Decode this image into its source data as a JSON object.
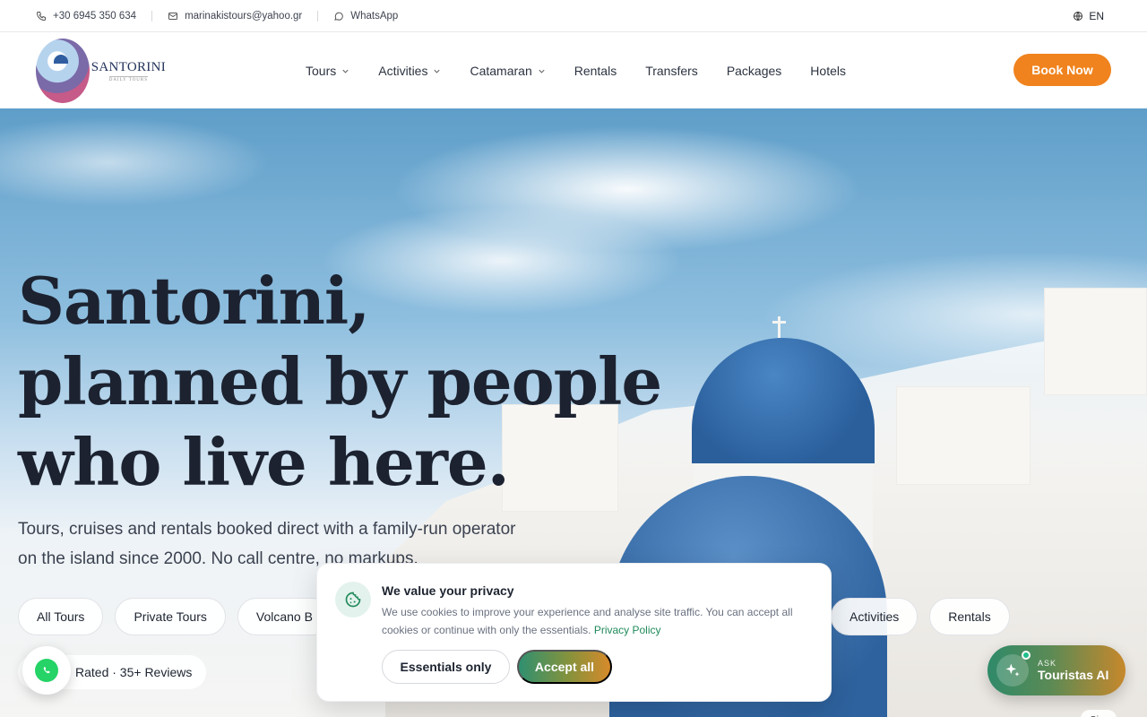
{
  "topbar": {
    "phone": "+30 6945 350 634",
    "email": "marinakistours@yahoo.gr",
    "whatsapp": "WhatsApp",
    "language": "EN"
  },
  "logo": {
    "title": "SANTORINI",
    "subtitle": "DAILY TOURS"
  },
  "nav": {
    "items": [
      {
        "label": "Tours",
        "has_dropdown": true
      },
      {
        "label": "Activities",
        "has_dropdown": true
      },
      {
        "label": "Catamaran",
        "has_dropdown": true
      },
      {
        "label": "Rentals",
        "has_dropdown": false
      },
      {
        "label": "Transfers",
        "has_dropdown": false
      },
      {
        "label": "Packages",
        "has_dropdown": false
      },
      {
        "label": "Hotels",
        "has_dropdown": false
      }
    ],
    "book_now": "Book Now"
  },
  "hero": {
    "title": "Santorini, planned by people who live here.",
    "subtitle": "Tours, cruises and rentals booked direct with a family-run operator on the island since 2000. No call centre, no markups.",
    "chips_left": [
      "All Tours",
      "Private Tours",
      "Volcano B"
    ],
    "chips_right": [
      "Activities",
      "Rentals"
    ],
    "rating": "Rated · 35+ Reviews"
  },
  "ask_ai": {
    "eyebrow": "ASK",
    "label": "Touristas AI"
  },
  "map_chip": "Oia",
  "cookie": {
    "title": "We value your privacy",
    "text": "We use cookies to improve your experience and analyse site traffic. You can accept all cookies or continue with only the essentials.",
    "link": "Privacy Policy",
    "essentials_label": "Essentials only",
    "accept_label": "Accept all"
  },
  "colors": {
    "accent_orange": "#f0831d",
    "brand_green": "#1f8a5b",
    "text_dark": "#1c2230"
  }
}
